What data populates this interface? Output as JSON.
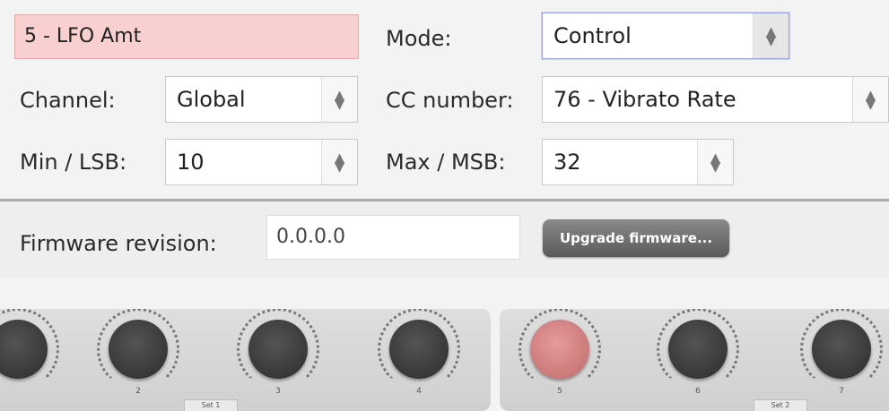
{
  "control": {
    "name_value": "5 - LFO Amt",
    "mode_label": "Mode:",
    "mode_value": "Control",
    "channel_label": "Channel:",
    "channel_value": "Global",
    "cc_label": "CC number:",
    "cc_value": "76 - Vibrato Rate",
    "min_label": "Min / LSB:",
    "min_value": "10",
    "max_label": "Max / MSB:",
    "max_value": "32"
  },
  "firmware": {
    "label": "Firmware revision:",
    "value": "0.0.0.0",
    "upgrade_button": "Upgrade firmware..."
  },
  "knob_panels": [
    {
      "set_label": "Set 1",
      "knobs": [
        "2",
        "3",
        "4"
      ]
    },
    {
      "set_label": "Set 2",
      "knobs": [
        "5",
        "6",
        "7"
      ]
    }
  ],
  "colors": {
    "selected_field_bg": "#f8d0d0",
    "active_knob": "#d98585",
    "knob": "#3d3d3d"
  },
  "active_knob": "5"
}
